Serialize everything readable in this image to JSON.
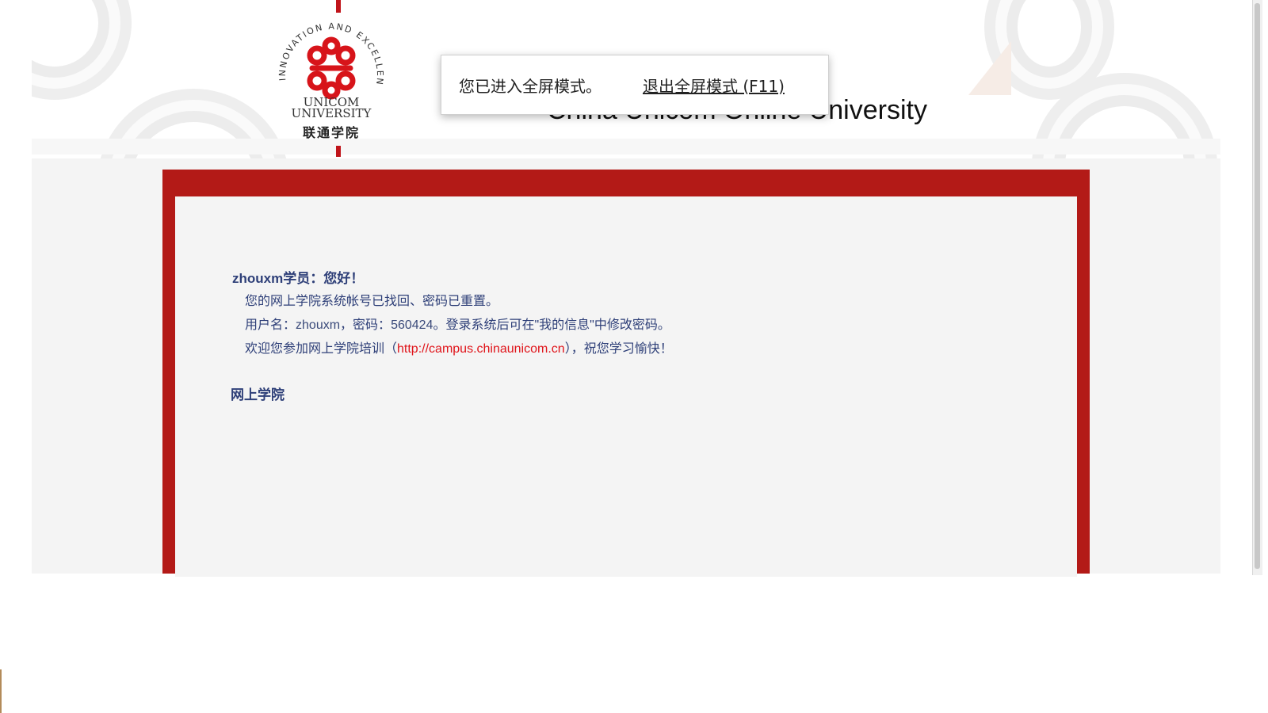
{
  "header": {
    "logo": {
      "ring_text": "INNOVATION AND EXCELLENCE",
      "name_en_line1": "UNICOM",
      "name_en_line2": "UNIVERSITY",
      "name_cn": "联通学院"
    },
    "site_title": "China Unicom Online University"
  },
  "fullscreen_notice": {
    "message": "您已进入全屏模式。",
    "exit_label": "退出全屏模式 (F11)"
  },
  "email": {
    "greeting": "zhouxm学员：您好！",
    "line1": "您的网上学院系统帐号已找回、密码已重置。",
    "line2_prefix": "用户名：",
    "username": "zhouxm",
    "line2_mid": "，密码：",
    "password": "560424",
    "line2_suffix": "。登录系统后可在\"我的信息\"中修改密码。",
    "line3_prefix": "欢迎您参加网上学院培训（",
    "link": "http://campus.chinaunicom.cn",
    "line3_suffix": "），祝您学习愉快！",
    "signature": "网上学院"
  },
  "colors": {
    "frame_red": "#b31a17",
    "text_navy": "#2e3f78",
    "link_red": "#e0141a",
    "logo_red": "#d7141a"
  }
}
